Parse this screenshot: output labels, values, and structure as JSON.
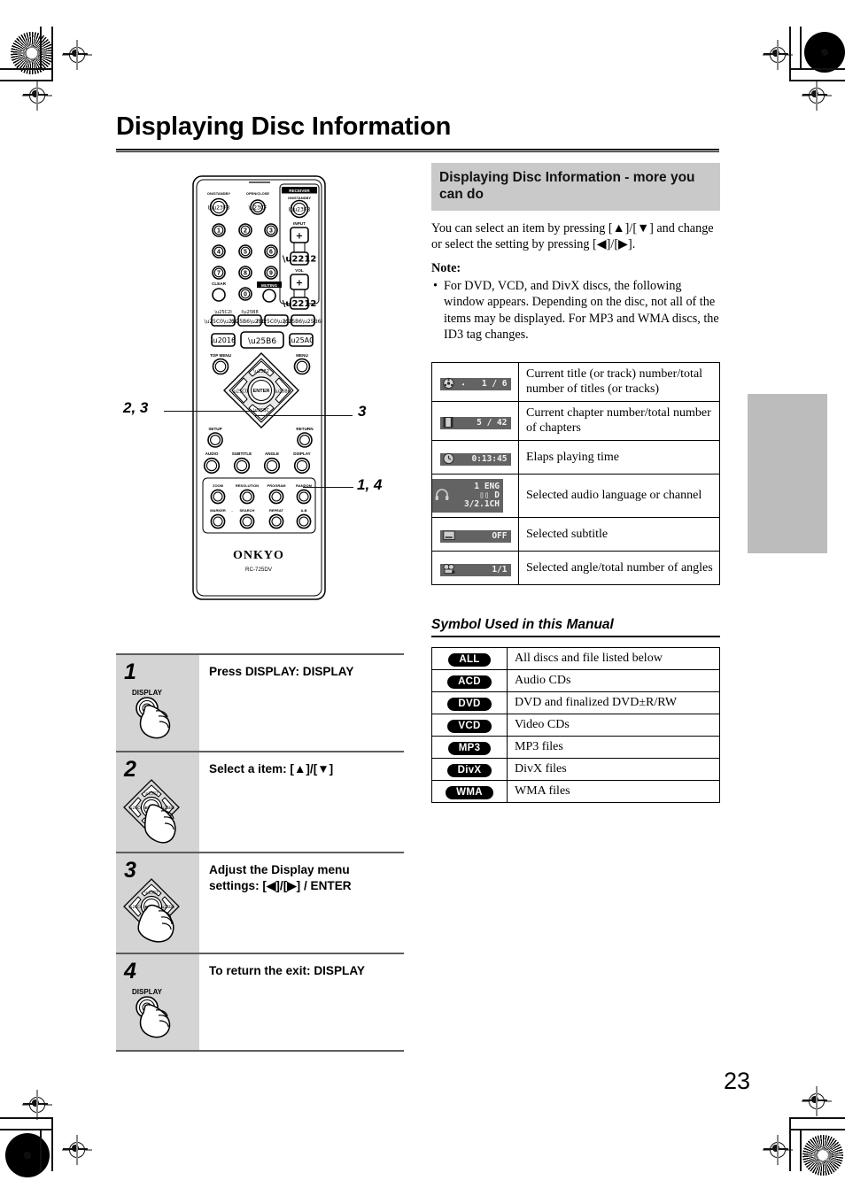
{
  "page": {
    "title": "Displaying Disc Information",
    "number": "23"
  },
  "remote": {
    "brand": "ONKYO",
    "model": "RC-725DV",
    "labels": {
      "on_standby": "ON/STANDBY",
      "open_close": "OPEN/CLOSE",
      "receiver": "RECEIVER",
      "receiver_on_standby": "ON/STANDBY",
      "input": "INPUT",
      "vol": "VOL",
      "clear": "CLEAR",
      "muting": "MUTING",
      "top_menu": "TOP MENU",
      "menu": "MENU",
      "setup": "SETUP",
      "return": "RETURN",
      "enter": "ENTER",
      "audio": "AUDIO",
      "subtitle": "SUBTITLE",
      "angle": "ANGLE",
      "display": "DISPLAY",
      "zoom": "ZOOM",
      "resolution": "RESOLUTION",
      "program": "PROGRAM",
      "random": "RANDOM",
      "marker": "MARKER",
      "search": "SEARCH",
      "repeat": "REPEAT",
      "ab": "A-B"
    },
    "numbers": [
      "1",
      "2",
      "3",
      "4",
      "5",
      "6",
      "7",
      "8",
      "9",
      "0"
    ],
    "callouts": [
      {
        "id": "callout-2-3",
        "label": "2, 3"
      },
      {
        "id": "callout-3",
        "label": "3"
      },
      {
        "id": "callout-1-4",
        "label": "1, 4"
      }
    ]
  },
  "right_column": {
    "section_heading": "Displaying Disc Information - more you can do",
    "intro": "You can select an item by pressing [▲]/[▼] and change or select the setting by pressing [◀]/[▶].",
    "note_label": "Note:",
    "note_bullet": "For DVD, VCD, and DivX discs, the following window appears. Depending on the disc, not all of the items may be displayed. For MP3 and WMA discs, the ID3 tag changes.",
    "bullet_glyph": "•"
  },
  "display_table": {
    "rows": [
      {
        "icon_name": "disc-title-icon",
        "icon_glyph": "⊙",
        "readout": "1 / 6",
        "extra": "◂",
        "description": "Current title (or track) number/total number of titles (or tracks)"
      },
      {
        "icon_name": "chapter-filmstrip-icon",
        "icon_glyph": "▥",
        "readout": "5 / 42",
        "extra": "",
        "description": "Current chapter number/total number of chapters"
      },
      {
        "icon_name": "clock-icon",
        "icon_glyph": "◴",
        "readout": "0:13:45",
        "extra": "",
        "description": "Elaps playing time"
      },
      {
        "icon_name": "headphones-audio-icon",
        "icon_glyph": "Ω",
        "readout": "1   ENG",
        "readout_line2": "▯▯ D",
        "readout_line3": "3/2.1CH",
        "extra": "",
        "description": "Selected audio language or channel"
      },
      {
        "icon_name": "subtitle-icon",
        "icon_glyph": "▧",
        "readout": "OFF",
        "extra": "",
        "description": "Selected subtitle"
      },
      {
        "icon_name": "camera-angle-icon",
        "icon_glyph": "☸",
        "readout": "1/1",
        "extra": "",
        "description": "Selected angle/total number of angles"
      }
    ]
  },
  "symbol_section": {
    "heading": "Symbol Used in this Manual",
    "rows": [
      {
        "badge": "ALL",
        "description": "All discs and file listed below"
      },
      {
        "badge": "ACD",
        "description": "Audio CDs"
      },
      {
        "badge": "DVD",
        "description": "DVD and finalized DVD±R/RW"
      },
      {
        "badge": "VCD",
        "description": "Video CDs"
      },
      {
        "badge": "MP3",
        "description": "MP3 files"
      },
      {
        "badge": "DivX",
        "description": "DivX files"
      },
      {
        "badge": "WMA",
        "description": "WMA files"
      }
    ]
  },
  "steps": [
    {
      "num": "1",
      "text": "Press DISPLAY: DISPLAY",
      "icon": "display-button-press-icon",
      "icon_label": "DISPLAY"
    },
    {
      "num": "2",
      "text": "Select a item: [▲]/[▼]",
      "icon": "dpad-up-down-press-icon",
      "icon_label": "ENTER"
    },
    {
      "num": "3",
      "text": "Adjust the Display menu settings: [◀]/[▶] / ENTER",
      "icon": "dpad-left-right-enter-press-icon",
      "icon_label": "ENTER"
    },
    {
      "num": "4",
      "text": "To return the exit: DISPLAY",
      "icon": "display-button-press-icon",
      "icon_label": "DISPLAY"
    }
  ],
  "colors": {
    "gray_heading_bg": "#c9c9c9",
    "step_cell_bg": "#d4d4d4",
    "oled_bg": "#636363",
    "tab_marker": "#bcbcbc",
    "rule": "#000000"
  }
}
